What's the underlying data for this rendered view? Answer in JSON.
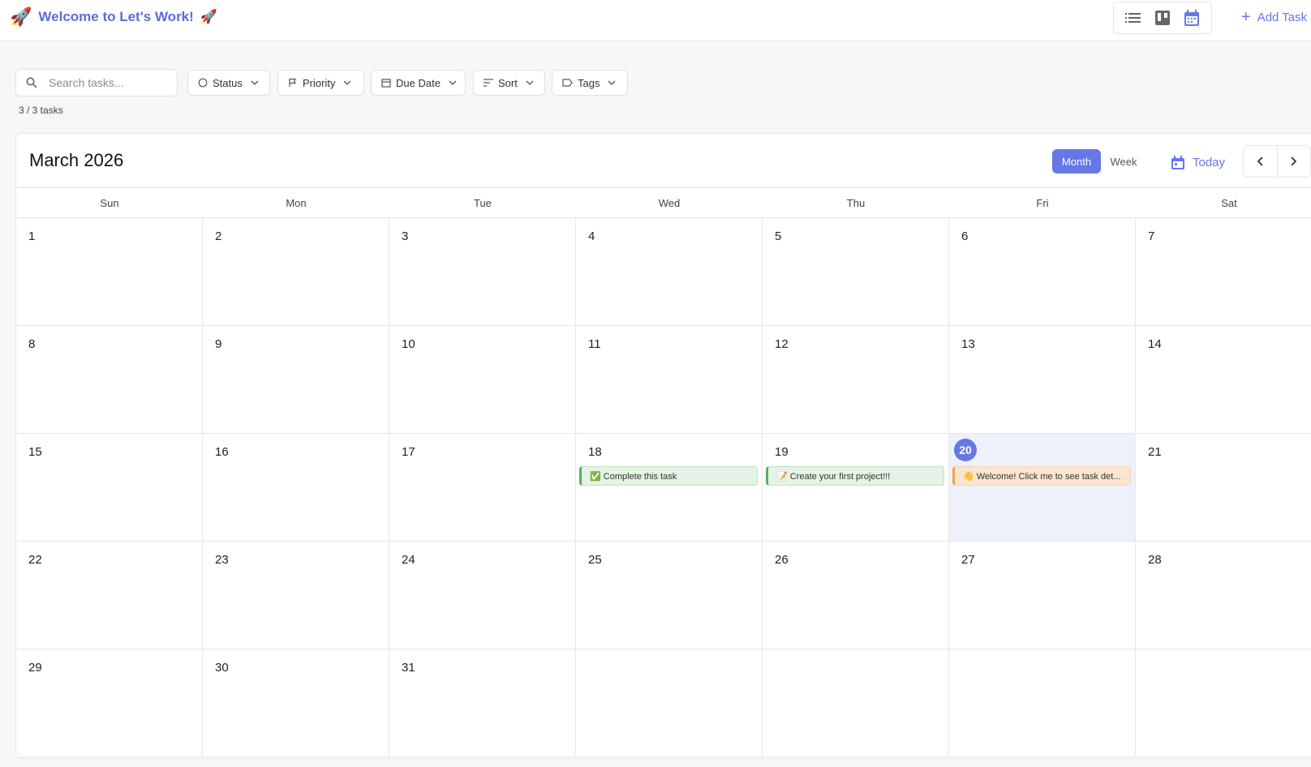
{
  "header": {
    "title": "Welcome to Let's Work!",
    "rocket_icon": "🚀",
    "views": [
      "list-view-icon",
      "kanban-view-icon",
      "calendar-view-icon"
    ],
    "add_task_label": "Add Task"
  },
  "filters": {
    "search_placeholder": "Search tasks...",
    "status_label": "Status",
    "priority_label": "Priority",
    "due_date_label": "Due Date",
    "sort_label": "Sort",
    "tags_label": "Tags",
    "task_count": "3 / 3 tasks"
  },
  "calendar": {
    "month_title": "March 2026",
    "month_label": "Month",
    "week_label": "Week",
    "today_label": "Today",
    "weekdays": [
      "Sun",
      "Mon",
      "Tue",
      "Wed",
      "Thu",
      "Fri",
      "Sat"
    ],
    "today_date": "20",
    "days": [
      [
        "1",
        "2",
        "3",
        "4",
        "5",
        "6",
        "7"
      ],
      [
        "8",
        "9",
        "10",
        "11",
        "12",
        "13",
        "14"
      ],
      [
        "15",
        "16",
        "17",
        "18",
        "19",
        "20",
        "21"
      ],
      [
        "22",
        "23",
        "24",
        "25",
        "26",
        "27",
        "28"
      ],
      [
        "29",
        "30",
        "31",
        "",
        "",
        "",
        ""
      ]
    ],
    "tasks": [
      {
        "date": "18",
        "text": "✅ Complete this task",
        "color": "green"
      },
      {
        "date": "19",
        "text": "📝 Create your first project!!!",
        "color": "green"
      },
      {
        "date": "20",
        "text": "👋 Welcome! Click me to see task det...",
        "color": "orange"
      }
    ]
  },
  "colors": {
    "accent": "#6677e6",
    "brand_title": "#5b6be0",
    "today_bg": "#eef1fb",
    "task_green": "#e4f3e4",
    "task_orange": "#fbe5cf"
  }
}
